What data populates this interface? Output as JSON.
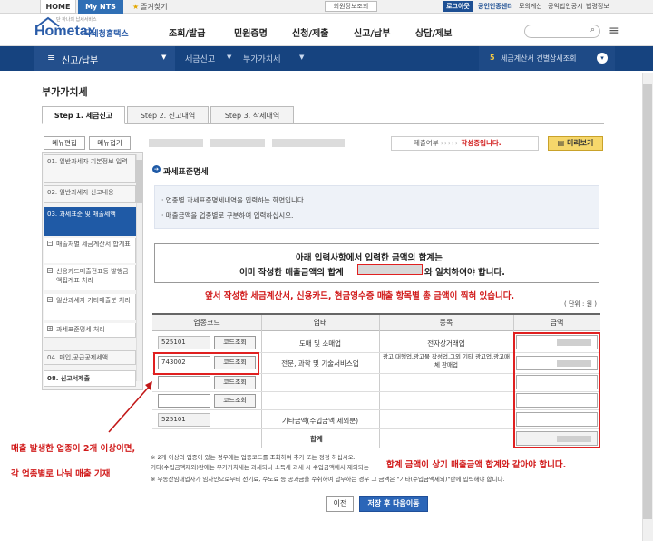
{
  "topbar": {
    "home": "HOME",
    "my_nts": "My NTS",
    "favorites": "즐겨찾기",
    "member_info": "회원정보조회",
    "logout": "로그아웃",
    "links": [
      "공인인증센터",
      "모의계산",
      "공익법인공시",
      "법령정보"
    ]
  },
  "header": {
    "logo_main": "Hometax",
    "logo_sub": "국세청홈택스",
    "logo_tag": "단 하나의 납세서비스",
    "gnb": [
      "조회/발급",
      "민원증명",
      "신청/제출",
      "신고/납부",
      "상담/제보"
    ]
  },
  "nav": {
    "level1": "신고/납부",
    "level2": "세금신고",
    "level3": "부가가치세",
    "notice_count": "5",
    "notice_text": "세금계산서 건별상세조회"
  },
  "page": {
    "title": "부가가치세",
    "steps": [
      "Step 1. 세금신고",
      "Step 2. 신고내역",
      "Step 3. 삭제내역"
    ]
  },
  "left_menu": {
    "edit": "메뉴편집",
    "fold": "메뉴접기",
    "items": [
      "01. 일반과세자 기본정보 입력",
      "02. 일반과세자 신고내용",
      "03. 과세표준 및 매출세액"
    ],
    "sub_items": [
      "매출처별 세금계산서 합계표",
      "신용카드매출전표등 발행금액집계표 처리",
      "일반과세자 기타매출분 처리",
      "과세표준명세 처리"
    ],
    "after_items": [
      "04. 매입,공급공제세액",
      "08. 신고서제출"
    ]
  },
  "status": {
    "label": "제출여부",
    "arrows": "›››››",
    "value": "작성중입니다.",
    "preview": "미리보기"
  },
  "section": {
    "title": "과세표준명세",
    "info": [
      "· 업종별 과세표준명세내역을 입력하는 화면입니다.",
      "· 매출금액을 업종별로 구분하여 입력하십시오."
    ],
    "notice_line1": "아래 입력사항에서  입력한 금액의 합계는",
    "notice_line2_a": "이미 작성한 매출금액의 합계",
    "notice_line2_b": "와 일치하여야 합니다.",
    "unit": "( 단위 : 원 )"
  },
  "table": {
    "headers": [
      "업종코드",
      "업태",
      "종목",
      "금액"
    ],
    "code_button": "코드조회",
    "rows": [
      {
        "code": "525101",
        "type": "도매 및 소매업",
        "item": "전자상거래업"
      },
      {
        "code": "743002",
        "type": "전문, 과학 및 기술서비스업",
        "item": "광고 대행업,광고물 작성업,그외 기타 광고업,광고매체 판매업"
      },
      {
        "code": "",
        "type": "",
        "item": ""
      },
      {
        "code": "",
        "type": "",
        "item": ""
      },
      {
        "code": "525101",
        "type": "기타금액(수입금액 제외분)",
        "item": ""
      }
    ],
    "total_label": "합계"
  },
  "notes": [
    "※ 2개 이상의 업종이 있는 경우에는 업종코드를 조회하여 추가 또는 정정 하십시오.",
    "    기타(수입금액제외)란에는 부가가치세는 과세되나 소득세 과세 시 수입금액에서 제외되는",
    "※ 부동산임대업자가 임차인으로부터 전기료, 수도료 등 공과금을 수취하여 납부하는 경우 그 금액은 \"기타(수입금액제외)\"란에 입력해야 합니다."
  ],
  "annotations": {
    "top": "앞서 작성한 세금계산서, 신용카드, 현금영수증 매출 항목별 총 금액이 찍혀 있습니다.",
    "left1": "매출 발생한 업종이 2개 이상이면,",
    "left2": "각 업종별로 나눠 매출 기재",
    "right": "합계 금액이 상기 매출금액 합계와 같아야 합니다."
  },
  "buttons": {
    "prev": "이전",
    "next": "저장 후 다음이동"
  },
  "colors": {
    "brand_blue": "#16437f",
    "accent_red": "#e02020",
    "preview_yellow": "#f6d76b"
  }
}
